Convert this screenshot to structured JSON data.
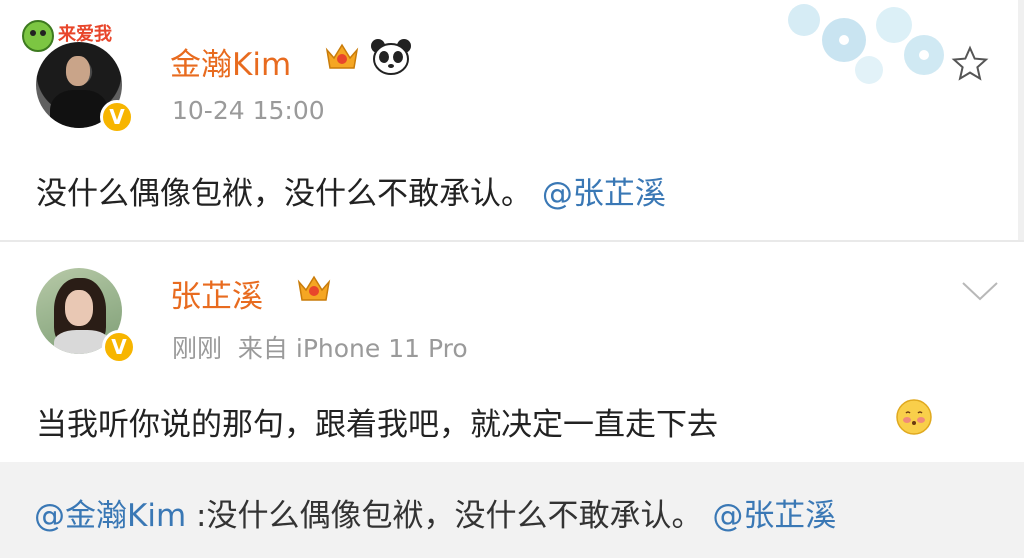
{
  "post1": {
    "author": "金瀚Kim",
    "timestamp": "10-24 15:00",
    "sticker_text": "来爱我",
    "text": "没什么偶像包袱，没什么不敢承认。",
    "mention": "@张芷溪"
  },
  "post2": {
    "author": "张芷溪",
    "time": "刚刚",
    "source": "来自 iPhone 11 Pro",
    "text": "当我听你说的那句，跟着我吧，就决定一直走下去"
  },
  "quote": {
    "mention_author": "@金瀚Kim",
    "separator": " :",
    "text": "没什么偶像包袱，没什么不敢承认。",
    "mention": "@张芷溪"
  },
  "icons": {
    "verified": "V",
    "star": "star-icon",
    "chevron": "chevron-down-icon",
    "crown": "crown-icon",
    "panda": "panda-icon",
    "emoji": "blushing-emoji-icon"
  },
  "colors": {
    "name": "#e86b1f",
    "mention": "#3a78b5",
    "meta": "#9a9a9a",
    "quote_bg": "#f2f2f2",
    "badge": "#f7b500"
  }
}
